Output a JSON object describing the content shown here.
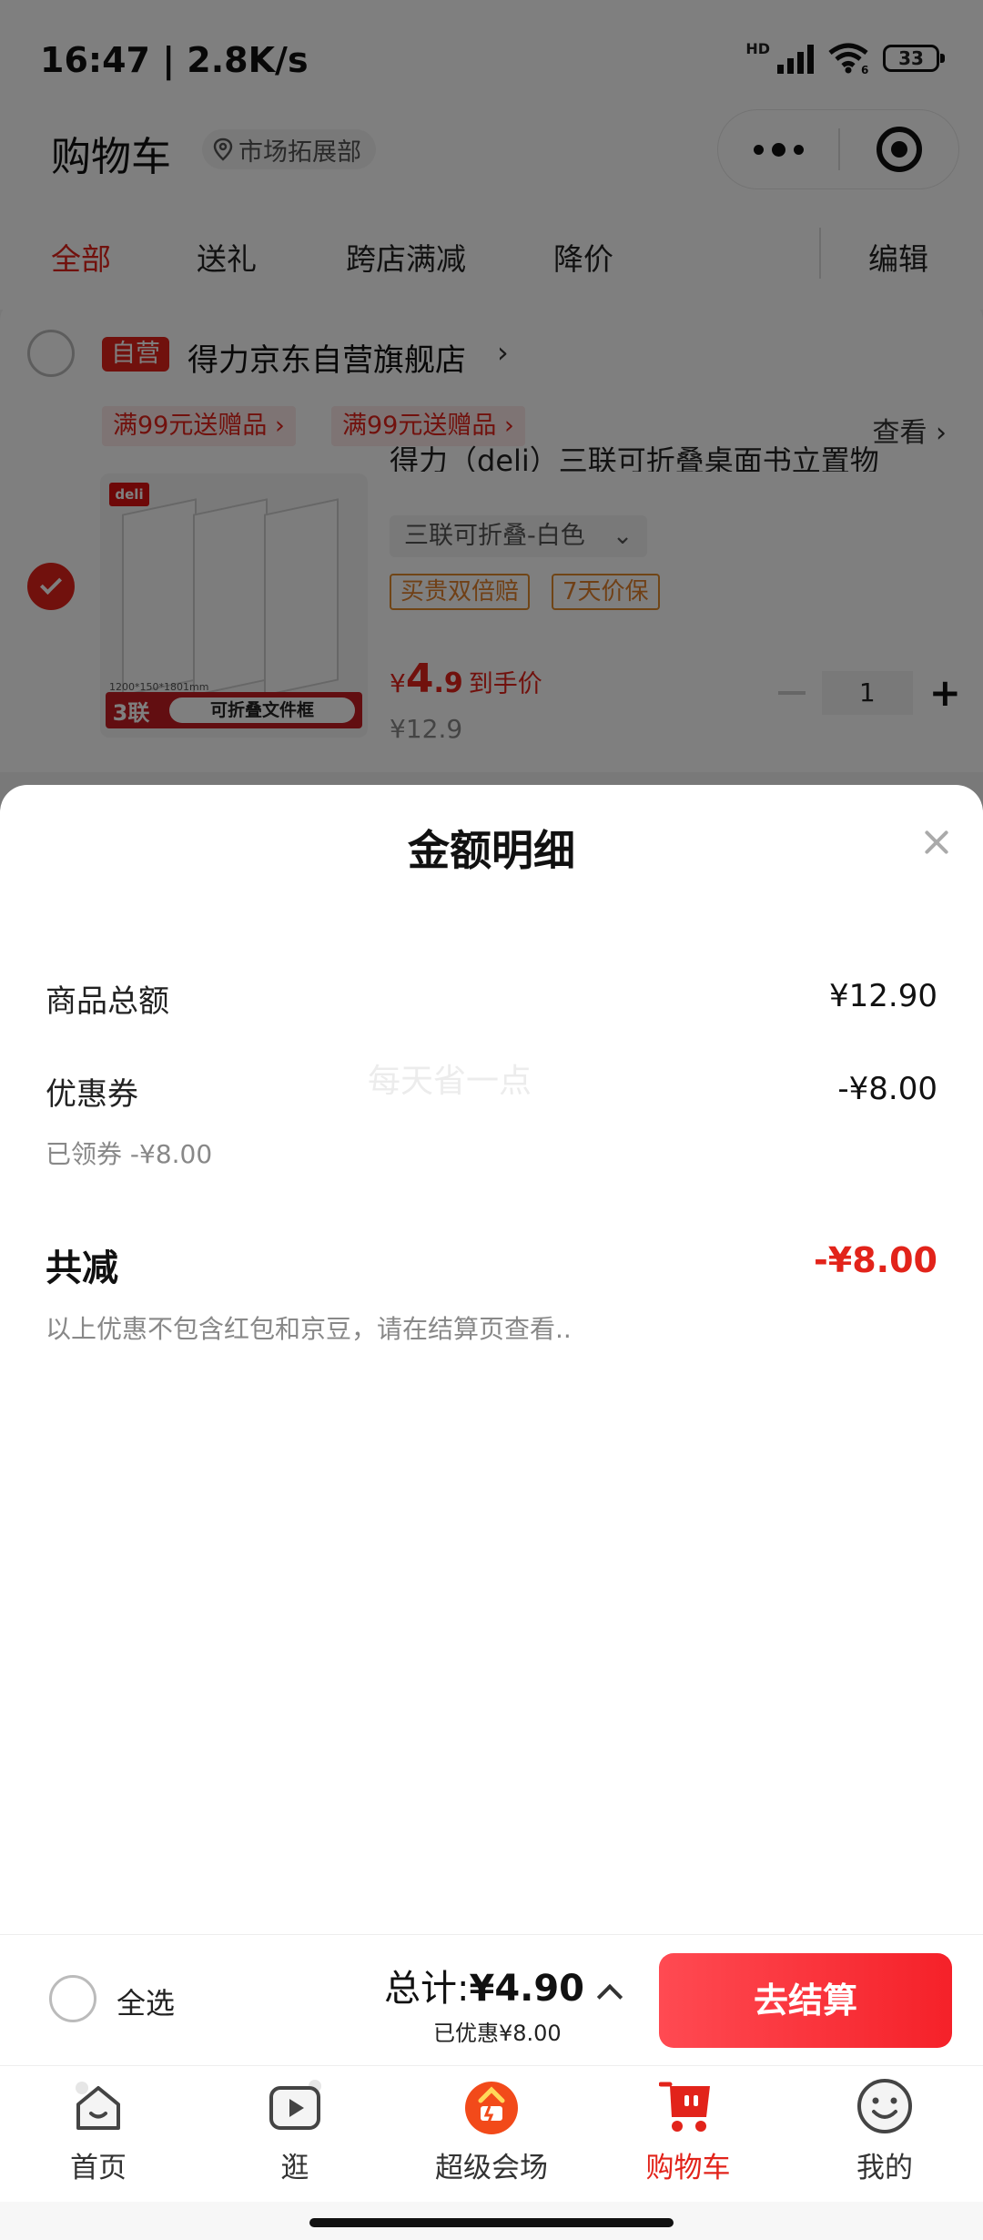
{
  "status": {
    "time": "16:47 | 2.8K/s",
    "network": "HD",
    "wifi_gen": "6",
    "battery": "33"
  },
  "header": {
    "title": "购物车",
    "location": "市场拓展部"
  },
  "tabs": [
    {
      "label": "全部",
      "active": true
    },
    {
      "label": "送礼",
      "active": false
    },
    {
      "label": "跨店满减",
      "active": false
    },
    {
      "label": "降价",
      "active": false
    },
    {
      "label": "编辑",
      "active": false
    }
  ],
  "store": {
    "badge": "自营",
    "name": "得力京东自营旗舰店",
    "arrow": "›",
    "promos": [
      "满99元送赠品 ›",
      "满99元送赠品 ›"
    ],
    "view_more": "查看 ›"
  },
  "product": {
    "brand_logo": "deli",
    "thumb_spec": "1200*150*1801mm",
    "thumb_count": "3联",
    "thumb_label": "可折叠文件框",
    "title": "得力（deli）三联可折叠桌面书立置物",
    "spec": "三联可折叠-白色",
    "spec_caret": "⌄",
    "tags": [
      "买贵双倍赔",
      "7天价保"
    ],
    "price_symbol": "¥",
    "price_int": "4",
    "price_dec": ".9",
    "price_note": "到手价",
    "original_price": "¥12.9",
    "quantity": "1",
    "checked": true
  },
  "sheet": {
    "title": "金额明细",
    "rows": [
      {
        "label": "商品总额",
        "value": "¥12.90"
      },
      {
        "label": "优惠券",
        "value": "-¥8.00"
      }
    ],
    "coupon_note": "已领券 -¥8.00",
    "watermark": "每天省一点",
    "total_label": "共减",
    "total_value": "-¥8.00",
    "disclaimer": "以上优惠不包含红包和京豆，请在结算页查看.."
  },
  "checkout": {
    "select_all": "全选",
    "sum_label": "总计:",
    "sum_value": "¥4.90",
    "saved": "已优惠¥8.00",
    "button": "去结算"
  },
  "tabbar": [
    {
      "label": "首页",
      "icon": "home-icon",
      "active": false
    },
    {
      "label": "逛",
      "icon": "play-icon",
      "active": false
    },
    {
      "label": "超级会场",
      "icon": "super-venue-icon",
      "active": false
    },
    {
      "label": "购物车",
      "icon": "cart-icon",
      "active": true
    },
    {
      "label": "我的",
      "icon": "smile-icon",
      "active": false
    }
  ],
  "colors": {
    "accent": "#e2231a",
    "tag": "#e0802c",
    "overlay": "rgba(0,0,0,0.5)"
  }
}
